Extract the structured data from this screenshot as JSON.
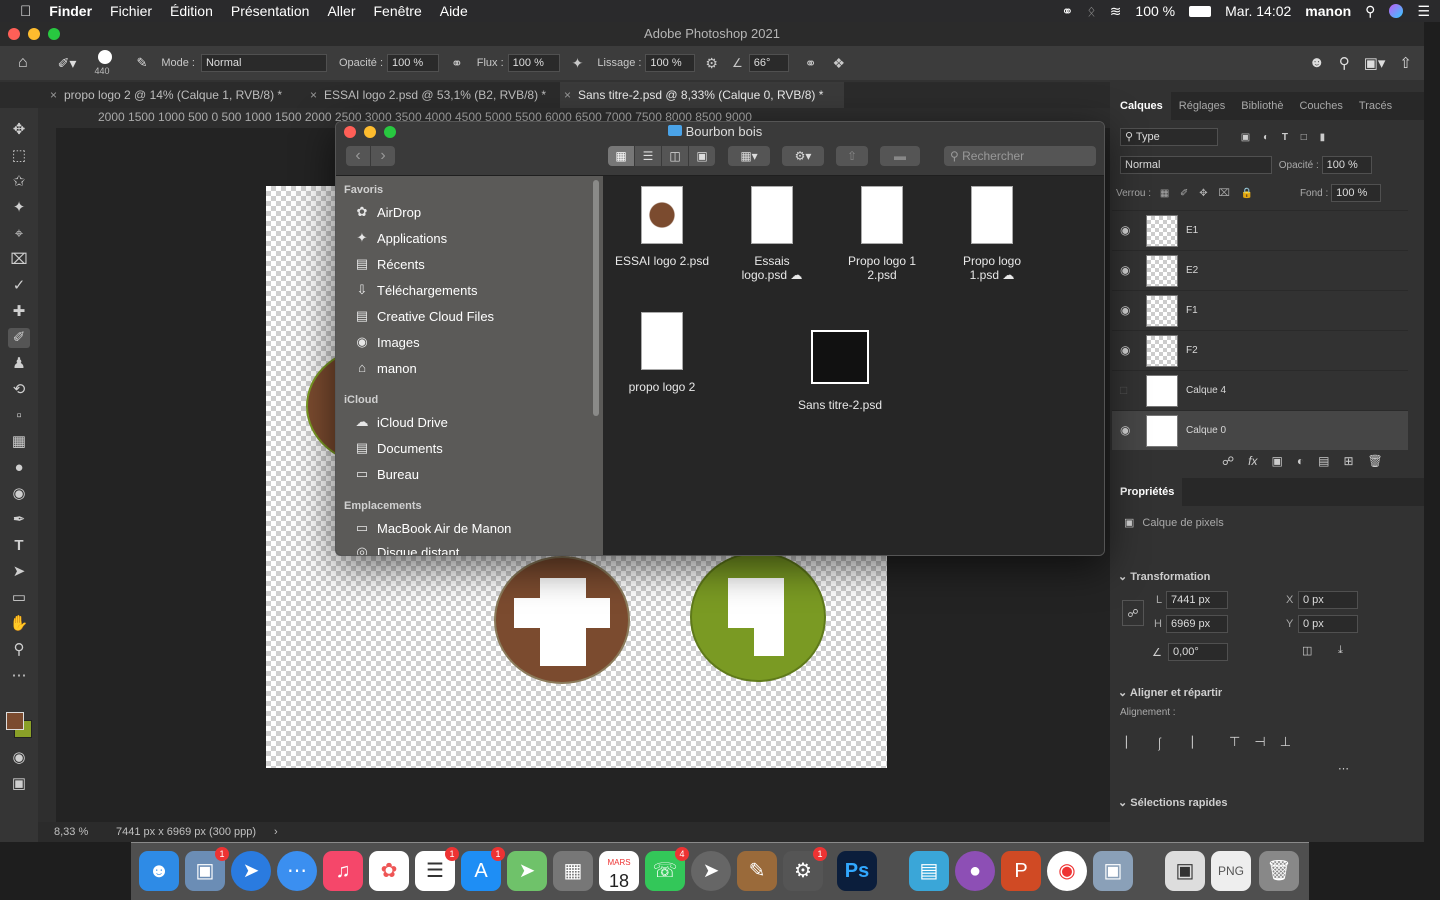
{
  "menubar": {
    "apple": "",
    "items": [
      "Finder",
      "Fichier",
      "Édition",
      "Présentation",
      "Aller",
      "Fenêtre",
      "Aide"
    ],
    "battery": "100 %",
    "datetime": "Mar. 14:02",
    "user": "manon"
  },
  "photoshop": {
    "title": "Adobe Photoshop 2021",
    "options": {
      "brush_size": "440",
      "mode_label": "Mode :",
      "mode_value": "Normal",
      "opacity_label": "Opacité :",
      "opacity_value": "100 %",
      "flux_label": "Flux :",
      "flux_value": "100 %",
      "lissage_label": "Lissage :",
      "lissage_value": "100 %",
      "angle_value": "66°"
    },
    "tabs": [
      "propo logo 2 @ 14% (Calque 1, RVB/8) *",
      "ESSAI logo 2.psd @ 53,1% (B2, RVB/8) *",
      "Sans titre-2.psd @ 8,33% (Calque 0, RVB/8) *"
    ],
    "ruler_top": "2000   1500   1000   500     0     500   1000   1500   2000   2500   3000   3500   4000   4500   5000   5500   6000   6500   7000   7500   8000   8500   9000",
    "status": {
      "zoom": "8,33 %",
      "size": "7441 px x 6969 px (300 ppp)"
    },
    "layers_panel": {
      "tabs": [
        "Calques",
        "Réglages",
        "Bibliothè",
        "Couches",
        "Tracés"
      ],
      "filter": "Type",
      "blend": "Normal",
      "opacity_label": "Opacité :",
      "opacity": "100 %",
      "lock_label": "Verrou :",
      "fill_label": "Fond :",
      "fill": "100 %",
      "layers": [
        {
          "name": "E1",
          "visible": true
        },
        {
          "name": "E2",
          "visible": true
        },
        {
          "name": "F1",
          "visible": true
        },
        {
          "name": "F2",
          "visible": true
        },
        {
          "name": "Calque 4",
          "visible": false
        },
        {
          "name": "Calque 0",
          "visible": true
        }
      ]
    },
    "properties": {
      "title": "Propriétés",
      "kind": "Calque de pixels",
      "transform_title": "Transformation",
      "w_label": "L",
      "w": "7441 px",
      "h_label": "H",
      "h": "6969 px",
      "x_label": "X",
      "x": "0 px",
      "y_label": "Y",
      "y": "0 px",
      "angle": "0,00°",
      "align_title": "Aligner et répartir",
      "align_label": "Alignement :",
      "quick_title": "Sélections rapides"
    }
  },
  "finder": {
    "title": "Bourbon bois",
    "search_placeholder": "Rechercher",
    "favorites_header": "Favoris",
    "favorites": [
      "AirDrop",
      "Applications",
      "Récents",
      "Téléchargements",
      "Creative Cloud Files",
      "Images",
      "manon"
    ],
    "icloud_header": "iCloud",
    "icloud": [
      "iCloud Drive",
      "Documents",
      "Bureau"
    ],
    "locations_header": "Emplacements",
    "locations": [
      "MacBook Air de Manon",
      "Disque distant"
    ],
    "files": [
      {
        "name1": "ESSAI logo 2.psd",
        "name2": ""
      },
      {
        "name1": "Essais",
        "name2": "logo.psd"
      },
      {
        "name1": "Propo logo 1",
        "name2": "2.psd"
      },
      {
        "name1": "Propo logo",
        "name2": "1.psd"
      },
      {
        "name1": "propo logo 2",
        "name2": ""
      },
      {
        "name1": "Sans titre-2.psd",
        "name2": ""
      }
    ]
  },
  "dock": {
    "calendar_month": "MARS",
    "calendar_day": "18",
    "badges": {
      "photos": "1",
      "reminders": "1",
      "appstore": "1",
      "messages": "4",
      "prefs": "1"
    }
  },
  "colors": {
    "accent": "#2e6ec9",
    "brown": "#7b4b2f",
    "green": "#7a9a23"
  }
}
